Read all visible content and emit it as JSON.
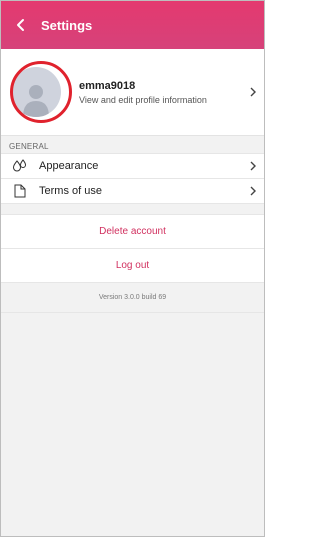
{
  "header": {
    "title": "Settings"
  },
  "profile": {
    "username": "emma9018",
    "subtitle": "View and edit profile information"
  },
  "general": {
    "label": "GENERAL",
    "items": [
      {
        "label": "Appearance",
        "icon": "droplets-icon"
      },
      {
        "label": "Terms of use",
        "icon": "document-icon"
      }
    ]
  },
  "actions": {
    "delete_label": "Delete account",
    "logout_label": "Log out"
  },
  "version": "Version 3.0.0 build 69",
  "colors": {
    "header": "#e4396f",
    "accent": "#d1305f",
    "highlight": "#e0222d"
  }
}
